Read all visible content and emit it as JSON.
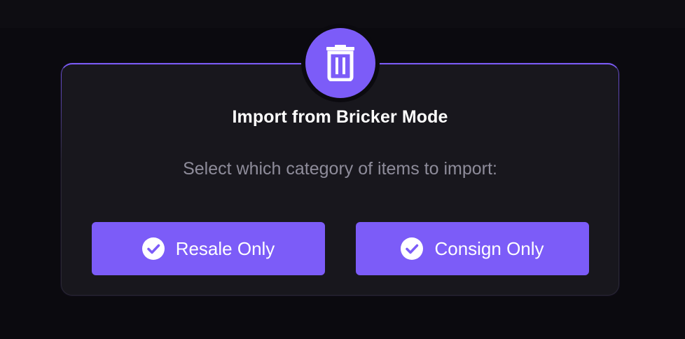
{
  "dialog": {
    "title": "Import from Bricker Mode",
    "subtitle": "Select which category of items to import:",
    "icon": "trash-icon",
    "buttons": [
      {
        "label": "Resale Only",
        "icon": "check-circle-icon"
      },
      {
        "label": "Consign Only",
        "icon": "check-circle-icon"
      }
    ]
  },
  "colors": {
    "accent": "#7c5cf8",
    "background": "#0b0a0f",
    "panel": "#18171d",
    "subtitle_text": "#8e8c9a"
  }
}
